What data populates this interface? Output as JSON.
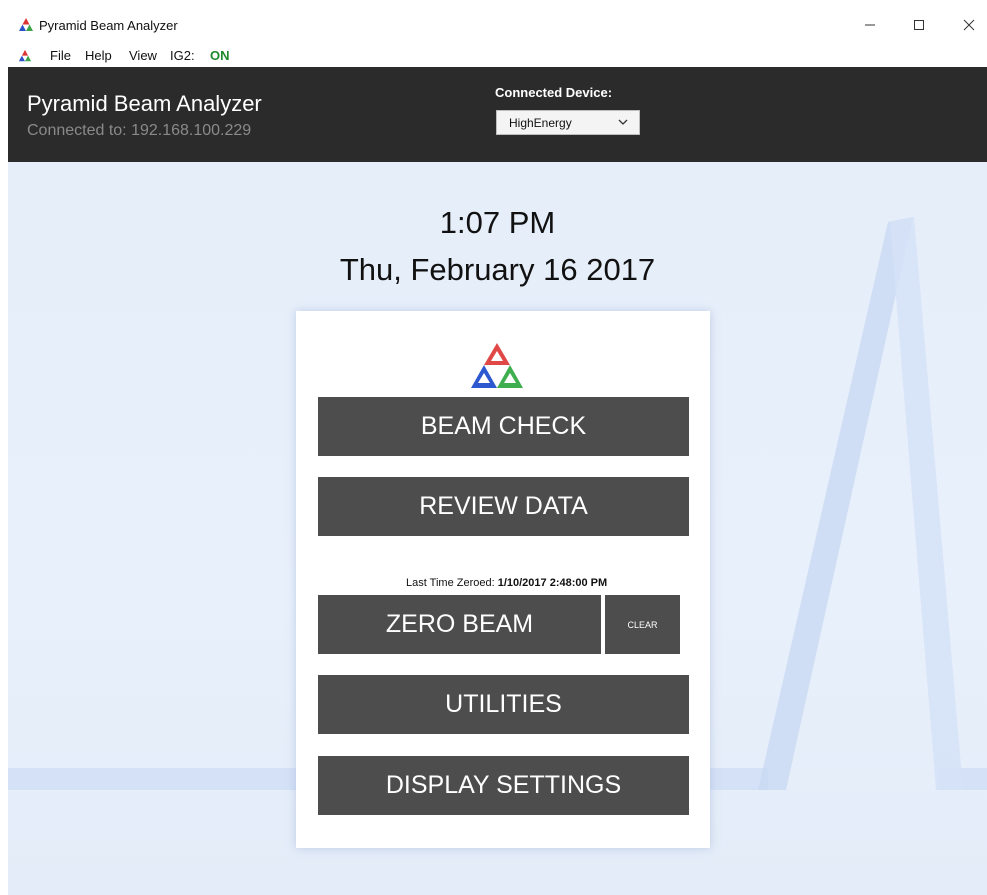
{
  "window": {
    "title": "Pyramid Beam Analyzer",
    "controls": {
      "minimize_icon": "minimize-icon",
      "maximize_icon": "maximize-icon",
      "close_icon": "close-icon"
    }
  },
  "menubar": {
    "items": [
      {
        "label": "File"
      },
      {
        "label": "Help"
      },
      {
        "label": "View"
      },
      {
        "label": "IG2:"
      }
    ],
    "ig2_state": "ON",
    "ig2_color": "#1f8a2a"
  },
  "header": {
    "title": "Pyramid Beam Analyzer",
    "connection": "Connected to: 192.168.100.229",
    "device_label": "Connected Device:",
    "device_selected": "HighEnergy"
  },
  "main": {
    "time": "1:07 PM",
    "date": "Thu, February 16 2017",
    "buttons": {
      "beam_check": "BEAM CHECK",
      "review_data": "REVIEW DATA",
      "zero_beam": "ZERO BEAM",
      "clear": "CLEAR",
      "utilities": "UTILITIES",
      "display_settings": "DISPLAY SETTINGS"
    },
    "last_zeroed_label": "Last Time Zeroed:",
    "last_zeroed_value": "1/10/2017 2:48:00 PM"
  },
  "colors": {
    "header_bg": "#2b2b2b",
    "button_bg": "#4d4d4d",
    "body_bg": "#e6eefa"
  }
}
